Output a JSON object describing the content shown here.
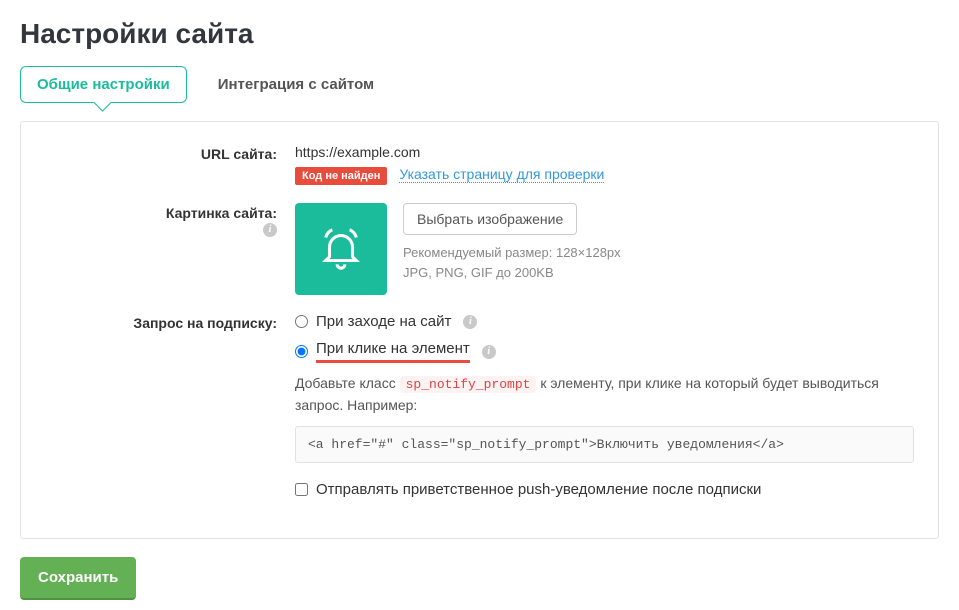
{
  "page_title": "Настройки сайта",
  "tabs": {
    "general": "Общие настройки",
    "integration": "Интеграция с сайтом"
  },
  "url_row": {
    "label": "URL сайта:",
    "value": "https://example.com",
    "badge": "Код не найден",
    "link_text": "Указать страницу для проверки"
  },
  "image_row": {
    "label": "Картинка сайта:",
    "button": "Выбрать изображение",
    "hint_line1": "Рекомендуемый размер: 128×128px",
    "hint_line2": "JPG, PNG, GIF до 200KB",
    "icon_name": "bell-icon"
  },
  "subscribe_row": {
    "label": "Запрос на подписку:",
    "radio_on_visit": "При заходе на сайт",
    "radio_on_click": "При клике на элемент",
    "desc_before": "Добавьте класс ",
    "code_class": "sp_notify_prompt",
    "desc_after": " к элементу, при клике на который будет выводиться запрос. Например:",
    "code_example": "<a href=\"#\" class=\"sp_notify_prompt\">Включить уведомления</a>",
    "checkbox_label": "Отправлять приветственное push-уведомление после подписки"
  },
  "save_button": "Сохранить",
  "colors": {
    "accent": "#1abc9c",
    "danger": "#e74c3c",
    "link": "#3498db",
    "success": "#64b054"
  }
}
